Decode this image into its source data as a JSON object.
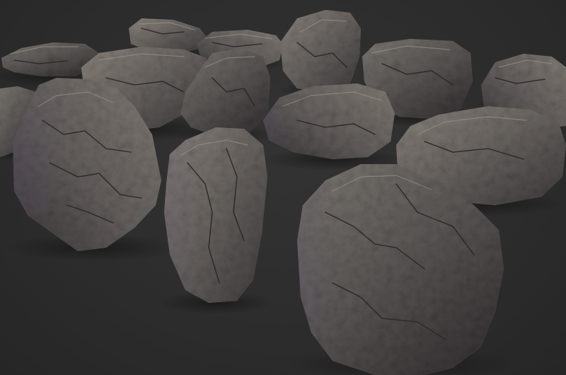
{
  "scene": {
    "background_color": "#2d2d2d",
    "subject": "rocks",
    "rock_count": 16,
    "rock_palette": [
      "#5f5b5a",
      "#6e6a66",
      "#7a7570",
      "#4a4648",
      "#3a3638",
      "#85807a"
    ],
    "shadow_color": "#1e1e1e",
    "highlight_color": "#9a948c",
    "tint_color": "#5a5068"
  }
}
